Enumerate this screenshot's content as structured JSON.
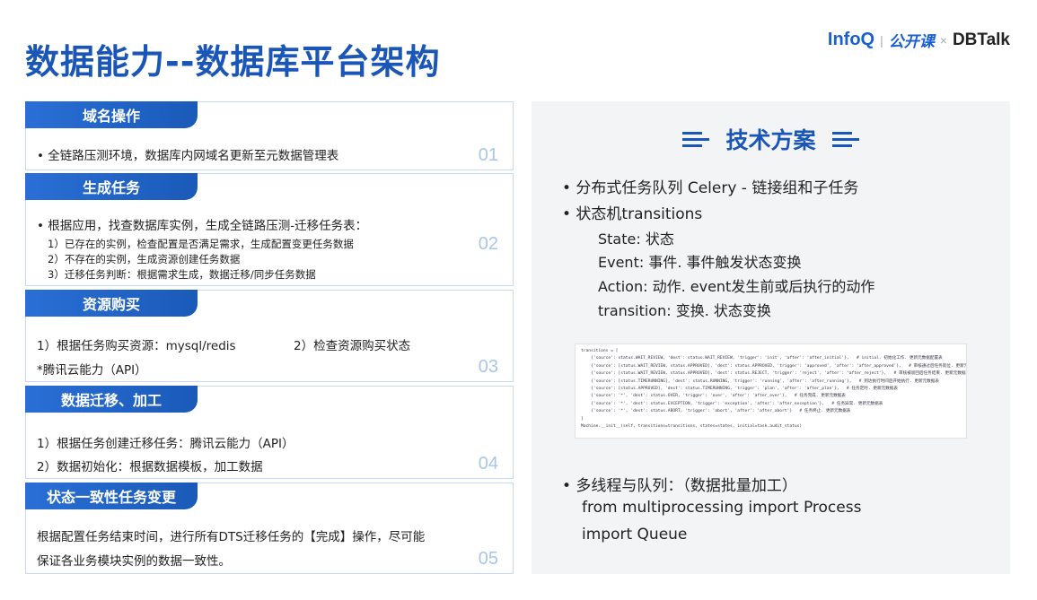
{
  "header": {
    "title": "数据能力--数据库平台架构",
    "brand_infoq": "InfoQ",
    "brand_sep1": "|",
    "brand_gongkai": "公开课",
    "brand_sep2": "×",
    "brand_dbtalk": "DBTalk"
  },
  "sections": [
    {
      "title": "域名操作",
      "num": "01",
      "lines": [
        "• 全链路压测环境，数据库内网域名更新至元数据管理表"
      ]
    },
    {
      "title": "生成任务",
      "num": "02",
      "lines": [
        "• 根据应用，找查数据库实例，生成全链路压测-迁移任务表："
      ],
      "sublines": [
        "1）已存在的实例，检查配置是否满足需求，生成配置变更任务数据",
        "2）不存在的实例，生成资源创建任务数据",
        "3）迁移任务判断：根据需求生成，数据迁移/同步任务数据"
      ]
    },
    {
      "title": "资源购买",
      "num": "03",
      "lines": [
        "1）根据任务购买资源：mysql/redis",
        "2）检查资源购买状态",
        "*腾讯云能力（API）"
      ]
    },
    {
      "title": "数据迁移、加工",
      "num": "04",
      "lines": [
        "1）根据任务创建迁移任务：腾讯云能力（API）",
        "2）数据初始化：根据数据模板，加工数据"
      ]
    },
    {
      "title": "状态一致性任务变更",
      "num": "05",
      "lines": [
        "根据配置任务结束时间，进行所有DTS迁移任务的【完成】操作，尽可能",
        "保证各业务模块实例的数据一致性。"
      ]
    }
  ],
  "panel": {
    "title": "技术方案",
    "bullets": [
      "• 分布式任务队列 Celery - 链接组和子任务",
      "• 状态机transitions"
    ],
    "sub": [
      "State: 状态",
      "Event: 事件. 事件触发状态变换",
      "Action: 动作. event发生前或后执行的动作",
      "transition: 变换. 状态变换"
    ],
    "code": "transitions = [\n    {'source': status.WAIT_REVIEW, 'dest': status.WAIT_REVIEW, 'trigger': 'init', 'after': 'after_initial'},   # initial. 初始化工作. 更新元数据配置表\n    {'source': [status.WAIT_REVIEW, status.APPROVED], 'dest': status.APPROVED, 'trigger': 'approved', 'after': 'after_approved'},   # 审核通过后任务就位. 更新元数据表\n    {'source': [status.WAIT_REVIEW, status.APPROVED], 'dest': status.REJECT, 'trigger': 'reject', 'after': 'after_reject'},   # 审核被驳回后任务结束. 更新元数据表\n    {'source': [status.TIMERUNNING], 'dest': status.RUNNING, 'trigger': 'running', 'after': 'after_running'},   # 到达执行时间后开始执行. 更新元数据表\n    {'source': [status.APPROVED], 'dest': status.TIMERUNNING, 'trigger': 'plan', 'after': 'after_plan'},   # 任务定时. 更新元数据表\n    {'source': '*', 'dest': status.OVER, 'trigger': 'over', 'after': 'after_over'},   # 任务完成. 更新元数据表\n    {'source': '*', 'dest': status.EXCEPTION, 'trigger': 'exception', 'after': 'after_exception'},   # 任务异常. 更新元数据表\n    {'source': '*', 'dest': status.ABORT, 'trigger': 'abort', 'after': 'after_abort'}   # 任务终止. 更新元数据表\n]\nMachine.__init__(self, transitions=transitions, states=states, initial=task.audit_status)",
    "bullet3": "• 多线程与队列：（数据批量加工）",
    "bullet3_l2": "from multiprocessing import Process",
    "bullet3_l3": "import Queue"
  }
}
